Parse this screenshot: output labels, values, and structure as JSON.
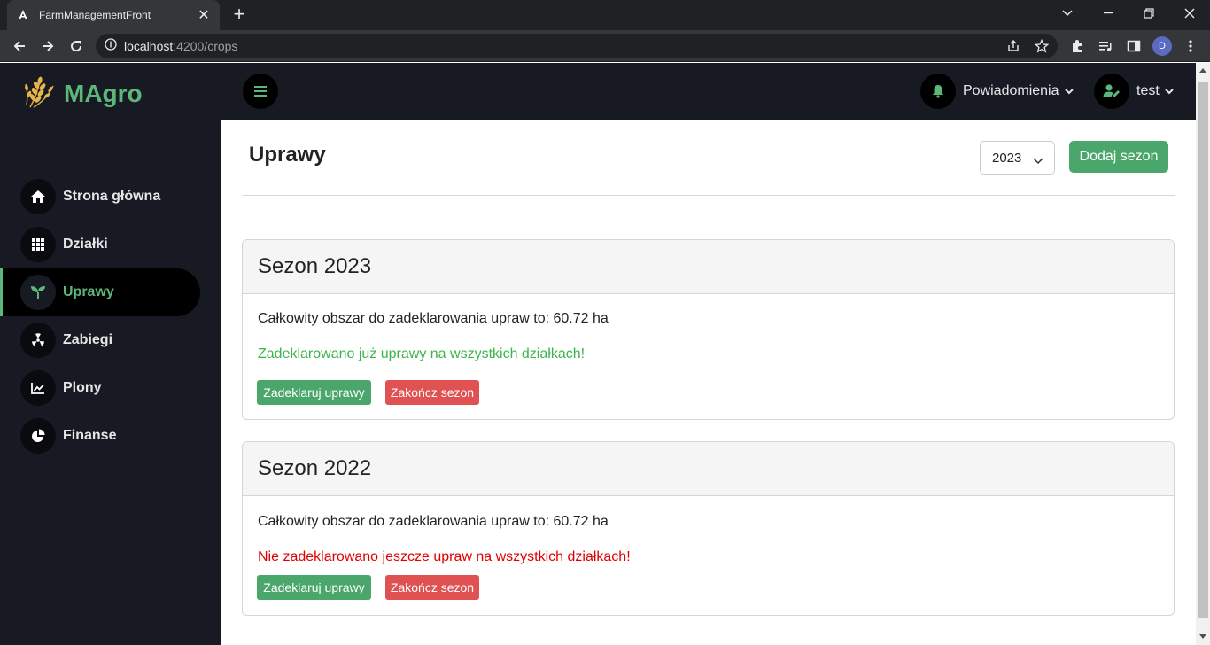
{
  "browser": {
    "tab_title": "FarmManagementFront",
    "url_host": "localhost",
    "url_rest": ":4200/crops",
    "profile_initial": "D"
  },
  "sidebar": {
    "logo_text": "MAgro",
    "items": [
      {
        "label": "Strona główna",
        "icon": "home-icon",
        "active": false
      },
      {
        "label": "Działki",
        "icon": "grid-icon",
        "active": false
      },
      {
        "label": "Uprawy",
        "icon": "sprout-icon",
        "active": true
      },
      {
        "label": "Zabiegi",
        "icon": "radiation-icon",
        "active": false
      },
      {
        "label": "Plony",
        "icon": "chart-line-icon",
        "active": false
      },
      {
        "label": "Finanse",
        "icon": "pie-chart-icon",
        "active": false
      }
    ]
  },
  "topbar": {
    "notifications_label": "Powiadomienia",
    "user_label": "test"
  },
  "page": {
    "title": "Uprawy",
    "year_selected": "2023",
    "add_season_label": "Dodaj sezon"
  },
  "seasons": [
    {
      "title": "Sezon 2023",
      "area_text": "Całkowity obszar do zadeklarowania upraw to: 60.72 ha",
      "status_text": "Zadeklarowano już uprawy na wszystkich działkach!",
      "status_color": "#3cb44b",
      "declare_label": "Zadeklaruj uprawy",
      "end_label": "Zakończ sezon"
    },
    {
      "title": "Sezon 2022",
      "area_text": "Całkowity obszar do zadeklarowania upraw to: 60.72 ha",
      "status_text": "Nie zadeklarowano jeszcze upraw na wszystkich działkach!",
      "status_color": "#e00000",
      "declare_label": "Zadeklaruj uprawy",
      "end_label": "Zakończ sezon"
    }
  ],
  "colors": {
    "accent": "#5cb87a",
    "button_green": "#4aa66b",
    "button_red": "#e05252",
    "sidebar_bg": "#171a23"
  }
}
